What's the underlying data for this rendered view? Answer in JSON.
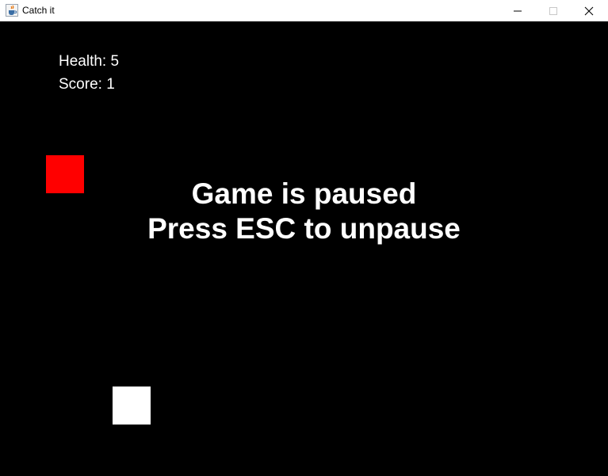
{
  "window": {
    "title": "Catch it",
    "icon": "java-cup-icon",
    "controls": [
      "minimize-icon",
      "maximize-icon",
      "close-icon"
    ]
  },
  "hud": {
    "health": "Health: 5",
    "score": "Score: 1"
  },
  "pause": {
    "line1": "Game is paused",
    "line2": "Press ESC to unpause"
  },
  "colors": {
    "background": "#000000",
    "text": "#ffffff",
    "falling_block": "#ff0000",
    "player_block": "#ffffff"
  }
}
